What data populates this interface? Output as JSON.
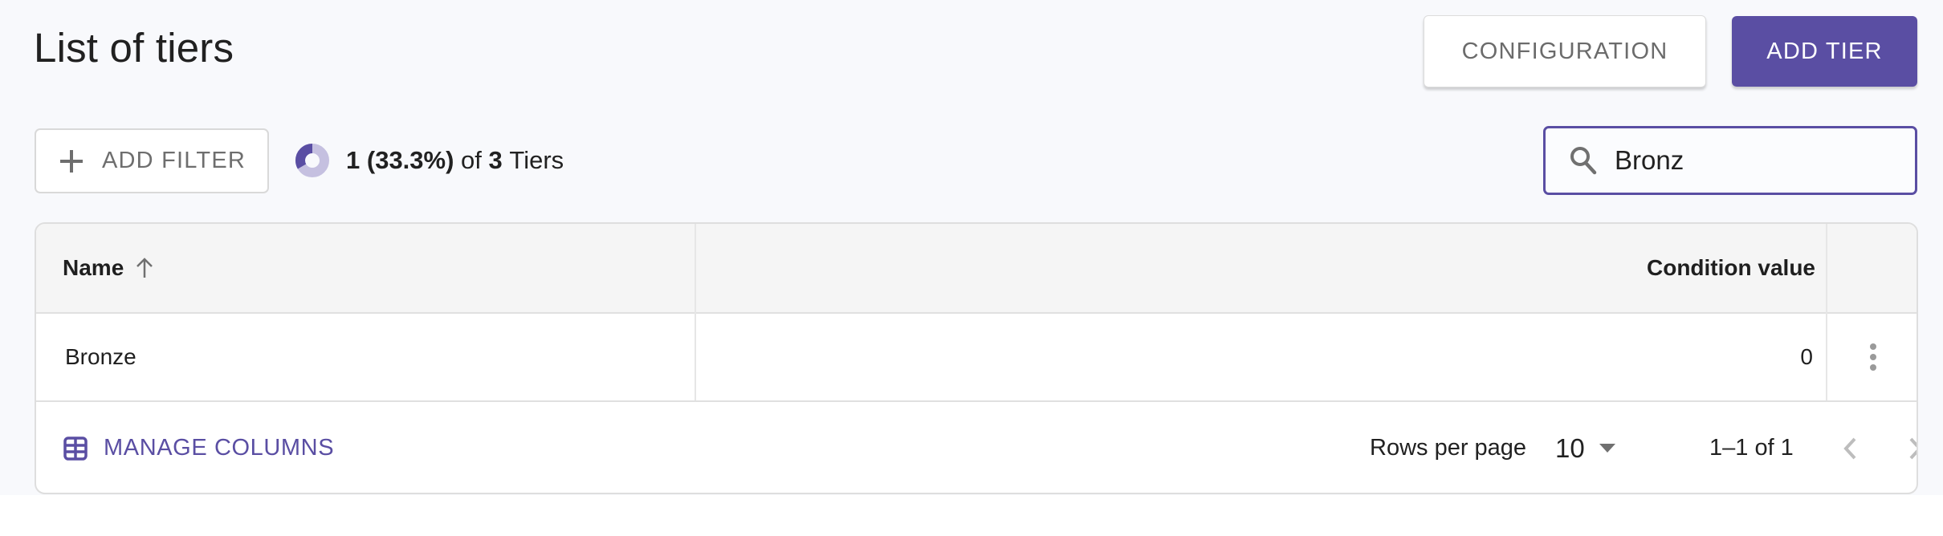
{
  "header": {
    "title": "List of tiers",
    "configuration_label": "CONFIGURATION",
    "add_tier_label": "ADD TIER"
  },
  "toolbar": {
    "add_filter_label": "ADD FILTER",
    "count": {
      "matched": "1",
      "percent": "(33.3%)",
      "of_label": "of",
      "total": "3",
      "entity_label": "Tiers",
      "fraction": 0.333
    },
    "search": {
      "value": "Bronz",
      "icon": "search-icon"
    }
  },
  "table": {
    "columns": [
      {
        "label": "Name",
        "sort": "ascending"
      },
      {
        "label": "Condition value"
      },
      {
        "label": ""
      }
    ],
    "rows": [
      {
        "name": "Bronze",
        "condition_value": "0"
      }
    ]
  },
  "footer": {
    "manage_columns_label": "MANAGE COLUMNS",
    "rows_per_page_label": "Rows per page",
    "rows_per_page_value": "10",
    "range_label": "1–1 of 1"
  },
  "colors": {
    "accent": "#5a4ea3",
    "accent_light": "#c5c0e0",
    "page_background": "#f8f9fc",
    "header_background": "#f5f5f5"
  }
}
